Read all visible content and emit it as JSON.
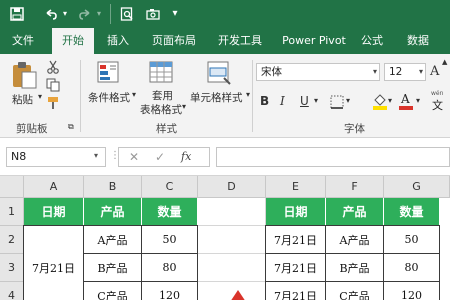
{
  "colors": {
    "brand": "#217346",
    "header_fill": "#2eaf5b",
    "font_color_red": "#d9342b",
    "highlight_yellow": "#ffe000"
  },
  "qat": {
    "icons": [
      "save-icon",
      "undo-icon",
      "redo-icon",
      "print-preview-icon",
      "camera-icon",
      "customize-qat-icon"
    ]
  },
  "tabs": [
    {
      "label": "文件"
    },
    {
      "label": "开始"
    },
    {
      "label": "插入"
    },
    {
      "label": "页面布局"
    },
    {
      "label": "开发工具"
    },
    {
      "label": "Power Pivot"
    },
    {
      "label": "公式"
    },
    {
      "label": "数据"
    }
  ],
  "ribbon": {
    "clipboard": {
      "paste": "粘贴",
      "group": "剪贴板"
    },
    "styles": {
      "conditional": "条件格式",
      "table_fmt_1": "套用",
      "table_fmt_2": "表格格式",
      "cell_style": "单元格样式",
      "group": "样式"
    },
    "font": {
      "name": "宋体",
      "size": "12",
      "bold": "B",
      "italic": "I",
      "underline": "U",
      "grow": "A",
      "shrink": "A",
      "highlight": "A",
      "group": "字体",
      "phonetic": "wén"
    }
  },
  "formula_bar": {
    "name_box": "N8",
    "cancel": "✕",
    "enter": "✓",
    "fx": "fx",
    "value": ""
  },
  "columns": [
    "A",
    "B",
    "C",
    "D",
    "E",
    "F",
    "G"
  ],
  "rows": [
    "1",
    "2",
    "3",
    "4"
  ],
  "left_table": {
    "headers": [
      "日期",
      "产品",
      "数量"
    ],
    "merged_date": "7月21日",
    "products": [
      "A产品",
      "B产品",
      "C产品"
    ],
    "qty": [
      "50",
      "80",
      "120"
    ]
  },
  "right_table": {
    "headers": [
      "日期",
      "产品",
      "数量"
    ],
    "rows": [
      [
        "7月21日",
        "A产品",
        "50"
      ],
      [
        "7月21日",
        "B产品",
        "80"
      ],
      [
        "7月21日",
        "C产品",
        "120"
      ]
    ]
  }
}
